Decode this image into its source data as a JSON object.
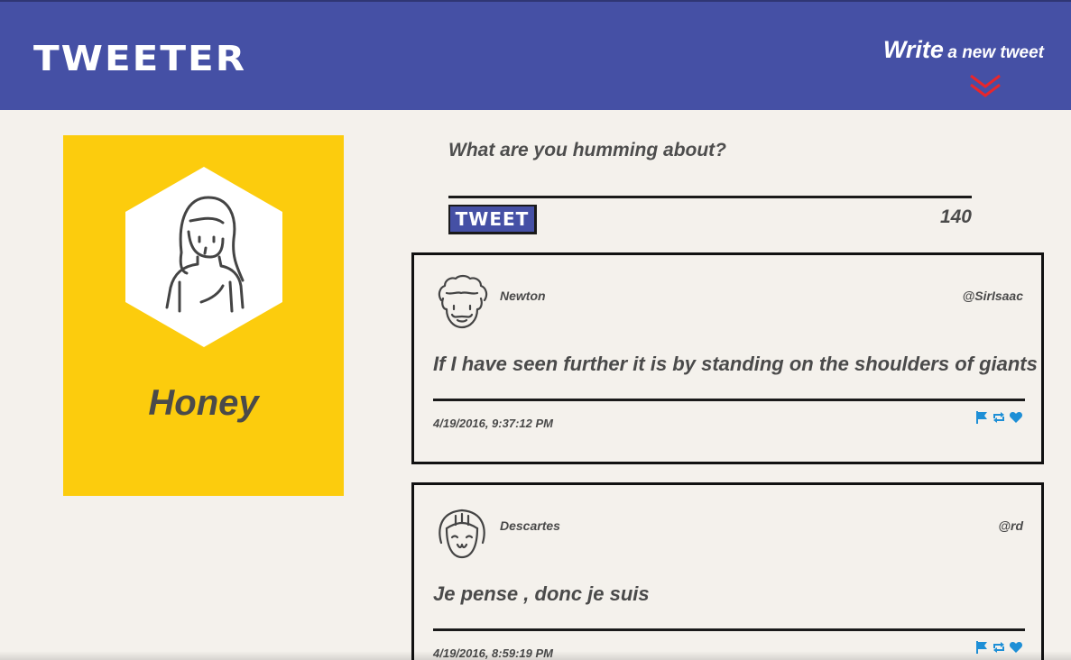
{
  "header": {
    "brand": "TWEETER",
    "compose_word1": "Write",
    "compose_word2": "a new tweet",
    "accent_color": "#e8262c",
    "bar_color": "#4550a5"
  },
  "profile": {
    "name": "Honey",
    "card_color": "#fccc0d"
  },
  "composer": {
    "placeholder": "What are you humming about?",
    "submit_label": "TWEET",
    "char_count": "140"
  },
  "tweets": [
    {
      "name": "Newton",
      "handle": "@SirIsaac",
      "text": "If I have seen further it is by standing on the shoulders of giants",
      "timestamp": "4/19/2016, 9:37:12 PM",
      "avatar_icon": "curly-hair-man-avatar-icon"
    },
    {
      "name": "Descartes",
      "handle": "@rd",
      "text": "Je pense , donc je suis",
      "timestamp": "4/19/2016, 8:59:19 PM",
      "avatar_icon": "bob-hair-smiling-avatar-icon"
    }
  ],
  "action_icons": [
    "flag-icon",
    "retweet-icon",
    "heart-icon"
  ],
  "action_color": "#1e8fd6"
}
